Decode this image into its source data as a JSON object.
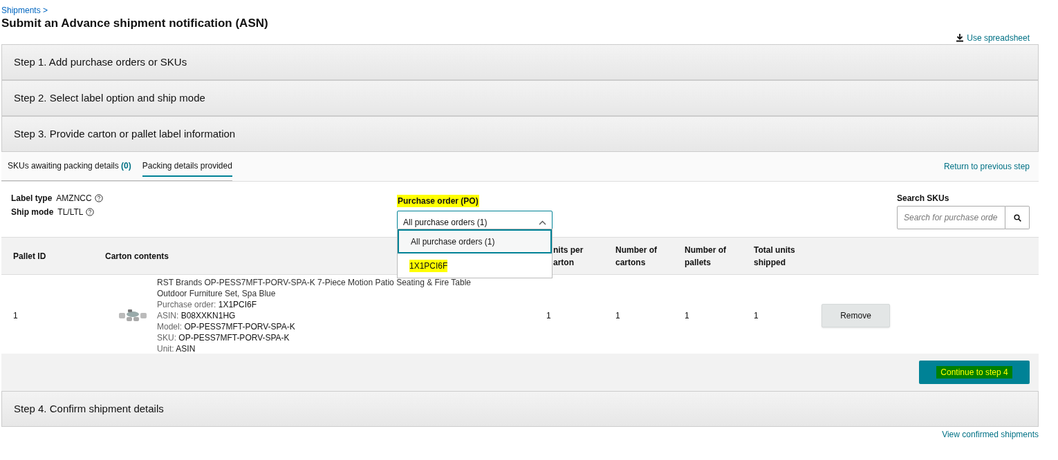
{
  "breadcrumb": "Shipments >",
  "title": "Submit an Advance shipment notification (ASN)",
  "spreadsheet_link": "Use spreadsheet",
  "steps_before": [
    {
      "label": "Step 1. Add purchase orders or SKUs"
    },
    {
      "label": "Step 2. Select label option and ship mode"
    },
    {
      "label": "Step 3. Provide carton or pallet label information"
    }
  ],
  "tabs": [
    {
      "label": "SKUs awaiting packing details",
      "count": "(0)",
      "selected": false
    },
    {
      "label": "Packing details provided",
      "selected": true
    }
  ],
  "return_link": "Return to previous step",
  "label_info": [
    {
      "label": "Label type",
      "value": "AMZNCC"
    },
    {
      "label": "Ship mode",
      "value": "TL/LTL"
    }
  ],
  "po_filter": {
    "label": "Purchase order (PO)",
    "highlighted": true,
    "value": "All purchase orders (1)",
    "expanded": true,
    "options": [
      {
        "label": "All purchase orders (1)",
        "selected": true,
        "highlighted": false
      },
      {
        "label": "1X1PCI6F",
        "selected": false,
        "highlighted": true
      }
    ]
  },
  "search": {
    "label": "Search SKUs",
    "placeholder": "Search for purchase orde"
  },
  "table": {
    "columns": [
      "Pallet ID",
      "Carton contents",
      "nits per arton",
      "Number of cartons",
      "Number of pallets",
      "Total units shipped"
    ],
    "rows": [
      {
        "pallet_id": "1",
        "title": "RST Brands OP-PESS7MFT-PORV-SPA-K 7-Piece Motion Patio Seating & Fire Table Outdoor Furniture Set, Spa Blue",
        "details": [
          {
            "label": "Purchase order:",
            "value": "1X1PCI6F"
          },
          {
            "label": "ASIN:",
            "value": "B08XXKN1HG"
          },
          {
            "label": "Model:",
            "value": "OP-PESS7MFT-PORV-SPA-K"
          },
          {
            "label": "SKU:",
            "value": "OP-PESS7MFT-PORV-SPA-K"
          },
          {
            "label": "Unit:",
            "value": "ASIN"
          }
        ],
        "units_per_carton": "1",
        "cartons": "1",
        "pallets": "1",
        "total_units": "1",
        "action": "Remove"
      }
    ]
  },
  "continue_button": {
    "label": "Continue to step 4",
    "highlighted": true
  },
  "steps_after": [
    {
      "label": "Step 4. Confirm shipment details"
    }
  ],
  "footer_link": "View confirmed shipments"
}
